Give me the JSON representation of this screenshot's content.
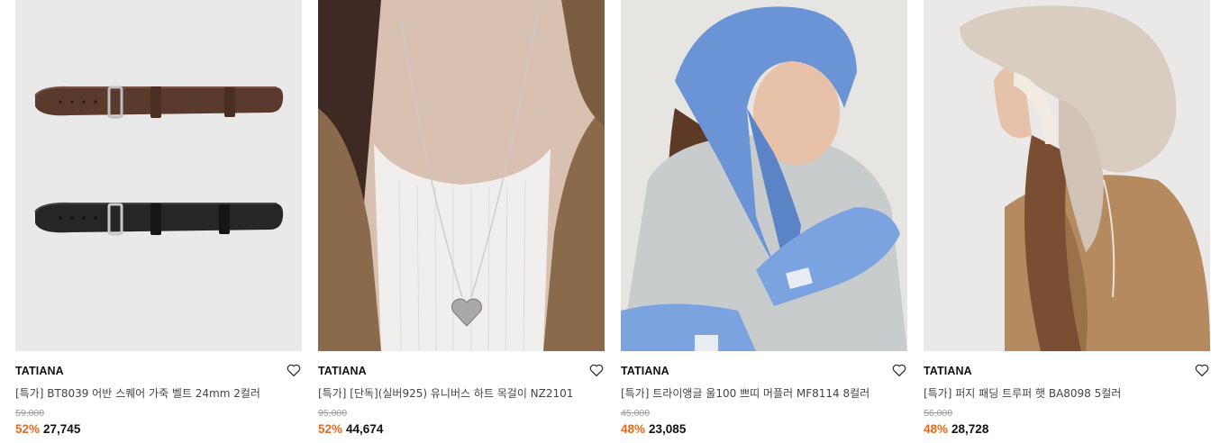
{
  "colors": {
    "discount": "#e86a1c",
    "brand_text": "#111111",
    "name_text": "#444444",
    "original_price": "#9a9a9a"
  },
  "products": [
    {
      "brand": "TATIANA",
      "name": "[특가] BT8039 어반 스퀘어 가죽 벨트 24mm 2컬러",
      "original_price": "59,000",
      "discount": "52%",
      "price": "27,745",
      "wishlist_icon": "heart-outline-icon",
      "image": "two leather belts, brown and black"
    },
    {
      "brand": "TATIANA",
      "name": "[특가] [단독](실버925) 유니버스 하트 목걸이 NZ2101",
      "original_price": "95,000",
      "discount": "52%",
      "price": "44,674",
      "wishlist_icon": "heart-outline-icon",
      "image": "silver heart pendant necklace on model"
    },
    {
      "brand": "TATIANA",
      "name": "[특가] 트라이앵글 울100 쁘띠 머플러 MF8114 8컬러",
      "original_price": "45,000",
      "discount": "48%",
      "price": "23,085",
      "wishlist_icon": "heart-outline-icon",
      "image": "model wearing blue wool kerchief and gloves"
    },
    {
      "brand": "TATIANA",
      "name": "[특가] 퍼지 패딩 트루퍼 햇 BA8098 5컬러",
      "original_price": "56,000",
      "discount": "48%",
      "price": "28,728",
      "wishlist_icon": "heart-outline-icon",
      "image": "model wearing beige padded trooper hat"
    }
  ]
}
